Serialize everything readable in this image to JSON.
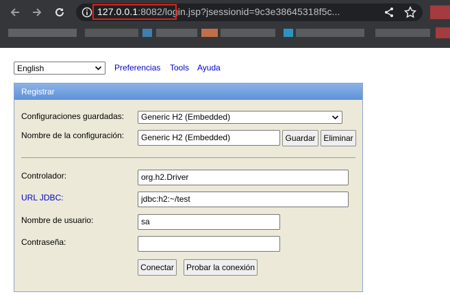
{
  "browser": {
    "url_host": "127.0.0.1",
    "url_port": ":8082/",
    "url_path": "login.jsp?jsessionid=9c3e38645318f5c..."
  },
  "page": {
    "language_selected": "English",
    "links": {
      "preferences": "Preferencias",
      "tools": "Tools",
      "help": "Ayuda"
    },
    "login": {
      "title": "Registrar",
      "saved_settings_label": "Configuraciones guardadas:",
      "saved_settings_value": "Generic H2 (Embedded)",
      "setting_name_label": "Nombre de la configuración:",
      "setting_name_value": "Generic H2 (Embedded)",
      "save_button": "Guardar",
      "remove_button": "Eliminar",
      "driver_label": "Controlador:",
      "driver_value": "org.h2.Driver",
      "jdbc_url_label": "URL JDBC:",
      "jdbc_url_value": "jdbc:h2:~/test",
      "user_label": "Nombre de usuario:",
      "user_value": "sa",
      "password_label": "Contraseña:",
      "password_value": "",
      "connect_button": "Conectar",
      "test_button": "Probar la conexión"
    }
  },
  "colors": {
    "chrome_bg": "#35363a",
    "omnibox_bg": "#202124",
    "highlight": "#e0201b",
    "panel_bg": "#ece9d8",
    "header_blue": "#5d92d9",
    "link_blue": "#0000cc"
  },
  "icons": [
    "back-arrow-icon",
    "forward-arrow-icon",
    "reload-icon",
    "info-icon",
    "share-icon",
    "star-icon",
    "chevron-down-icon"
  ]
}
